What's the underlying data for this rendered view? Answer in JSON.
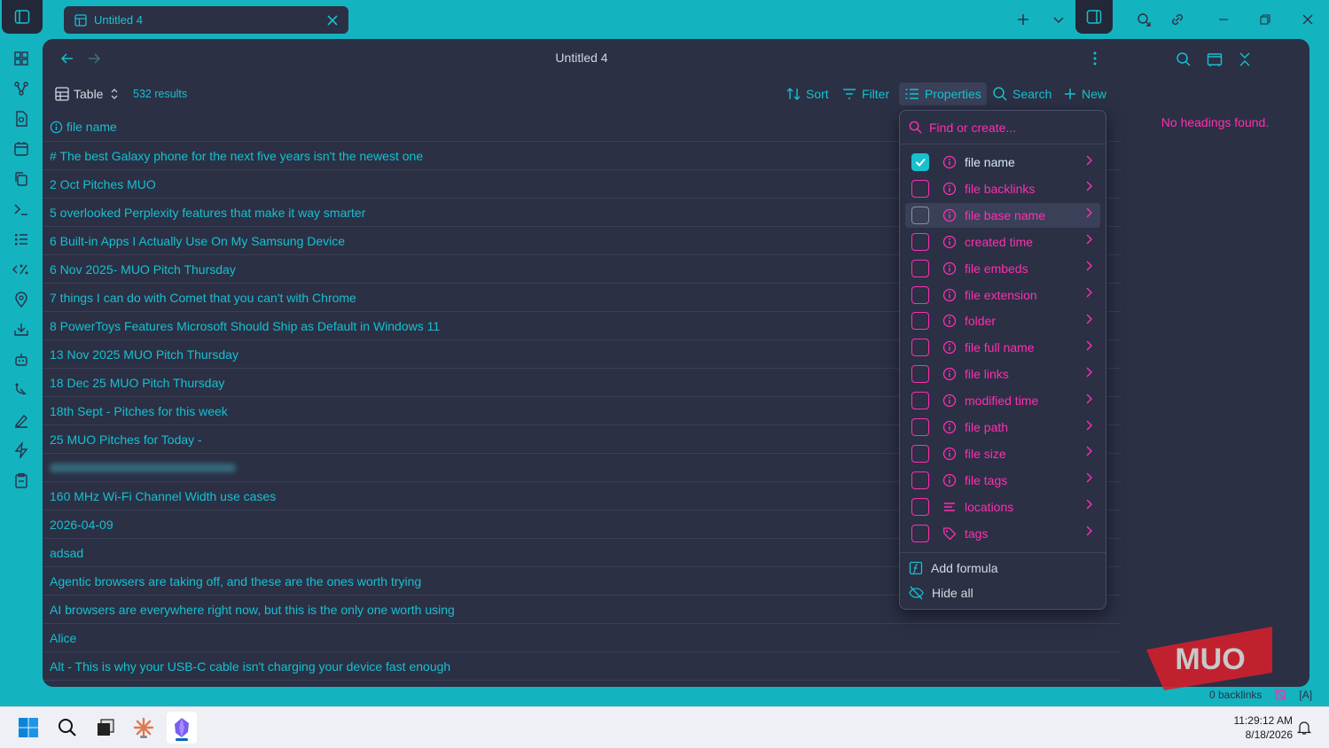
{
  "window": {
    "tab_title": "Untitled 4"
  },
  "header": {
    "title": "Untitled 4"
  },
  "toolbar": {
    "view_label": "Table",
    "results": "532 results",
    "sort_label": "Sort",
    "filter_label": "Filter",
    "properties_label": "Properties",
    "search_label": "Search",
    "new_label": "New"
  },
  "table": {
    "column_header": "file name",
    "rows": [
      "# The best Galaxy phone for the next five years isn't the newest one",
      "2 Oct Pitches MUO",
      "5 overlooked Perplexity features that make it way smarter",
      "6 Built-in Apps I Actually Use On My Samsung Device",
      "6 Nov 2025- MUO Pitch Thursday",
      "7 things I can do with Comet that you can't with Chrome",
      "8 PowerToys Features Microsoft Should Ship as Default in Windows 11",
      "13 Nov 2025 MUO Pitch Thursday",
      "18 Dec 25 MUO Pitch Thursday",
      "18th Sept - Pitches for this week",
      "25 MUO Pitches for Today -",
      "",
      "160 MHz Wi-Fi Channel Width use cases",
      "2026-04-09",
      "adsad",
      "Agentic browsers are taking off, and these are the ones worth trying",
      "AI browsers are everywhere right now, but this is the only one worth using",
      "Alice",
      "Alt - This is why your USB-C cable isn't charging your device fast enough"
    ]
  },
  "properties_menu": {
    "search_placeholder": "Find or create...",
    "items": [
      {
        "label": "file name",
        "checked": true,
        "icon": "info-icon"
      },
      {
        "label": "file backlinks",
        "checked": false,
        "icon": "info-icon"
      },
      {
        "label": "file base name",
        "checked": false,
        "icon": "info-icon"
      },
      {
        "label": "created time",
        "checked": false,
        "icon": "info-icon"
      },
      {
        "label": "file embeds",
        "checked": false,
        "icon": "info-icon"
      },
      {
        "label": "file extension",
        "checked": false,
        "icon": "info-icon"
      },
      {
        "label": "folder",
        "checked": false,
        "icon": "info-icon"
      },
      {
        "label": "file full name",
        "checked": false,
        "icon": "info-icon"
      },
      {
        "label": "file links",
        "checked": false,
        "icon": "info-icon"
      },
      {
        "label": "modified time",
        "checked": false,
        "icon": "info-icon"
      },
      {
        "label": "file path",
        "checked": false,
        "icon": "info-icon"
      },
      {
        "label": "file size",
        "checked": false,
        "icon": "info-icon"
      },
      {
        "label": "file tags",
        "checked": false,
        "icon": "info-icon"
      },
      {
        "label": "locations",
        "checked": false,
        "icon": "list-icon"
      },
      {
        "label": "tags",
        "checked": false,
        "icon": "tag-icon"
      }
    ],
    "add_formula_label": "Add formula",
    "hide_all_label": "Hide all"
  },
  "right_sidebar": {
    "empty_message": "No headings found."
  },
  "statusbar": {
    "backlinks": "0 backlinks",
    "mode": "[A]"
  },
  "watermark": {
    "text": "MUO"
  },
  "taskbar": {
    "time": "11:29:12 AM",
    "date": "8/18/2026"
  },
  "colors": {
    "accent": "#16c0cf",
    "pink": "#ff2fb0",
    "background": "#2b3045",
    "frame": "#14b3c0"
  }
}
